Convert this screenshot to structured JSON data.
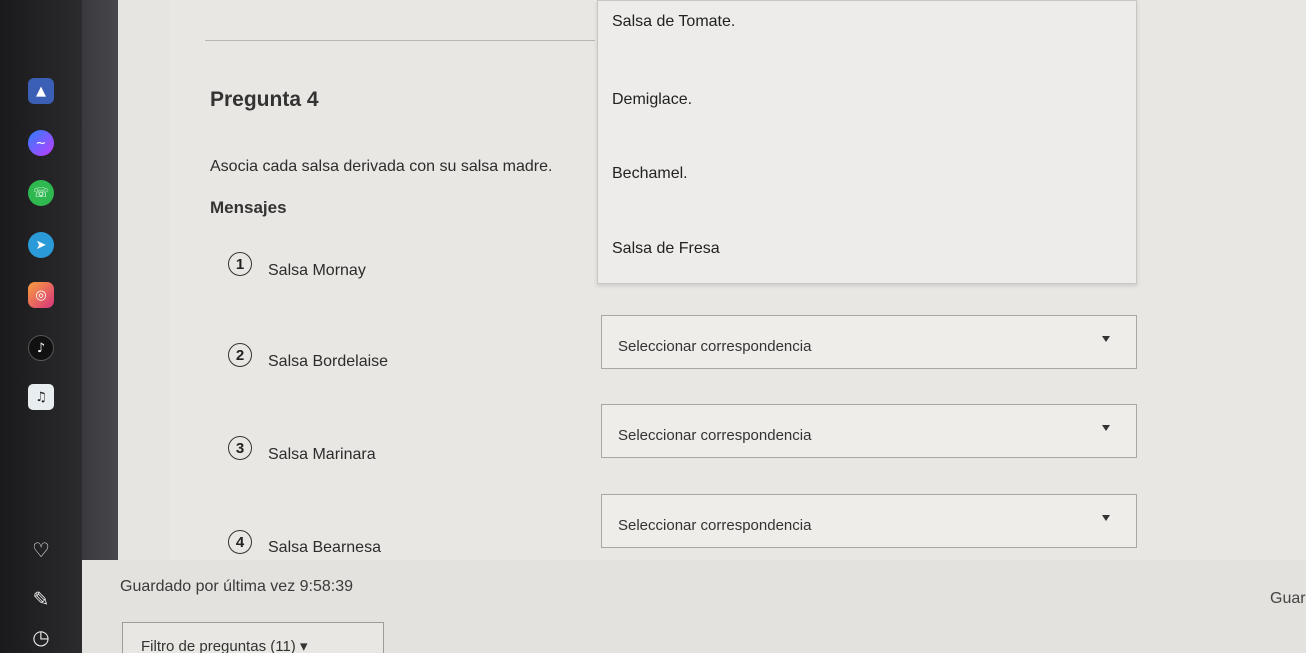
{
  "question": {
    "title": "Pregunta 4",
    "instruction": "Asocia cada salsa derivada con su salsa madre.",
    "section_label": "Mensajes"
  },
  "items": [
    {
      "number": "1",
      "label": "Salsa Mornay"
    },
    {
      "number": "2",
      "label": "Salsa Bordelaise"
    },
    {
      "number": "3",
      "label": "Salsa Marinara"
    },
    {
      "number": "4",
      "label": "Salsa Bearnesa"
    }
  ],
  "dropdown_options": [
    "Salsa de Tomate.",
    "Demiglace.",
    "Bechamel.",
    "Salsa de Fresa"
  ],
  "selects": [
    {
      "value": "Seleccionar correspondencia"
    },
    {
      "value": "Seleccionar correspondencia"
    },
    {
      "value": "Seleccionar correspondencia"
    }
  ],
  "footer": {
    "saved_text": "Guardado por última vez 9:58:39",
    "save_button_partial": "Guar",
    "filter_label": "Filtro de preguntas (11) ▾"
  }
}
